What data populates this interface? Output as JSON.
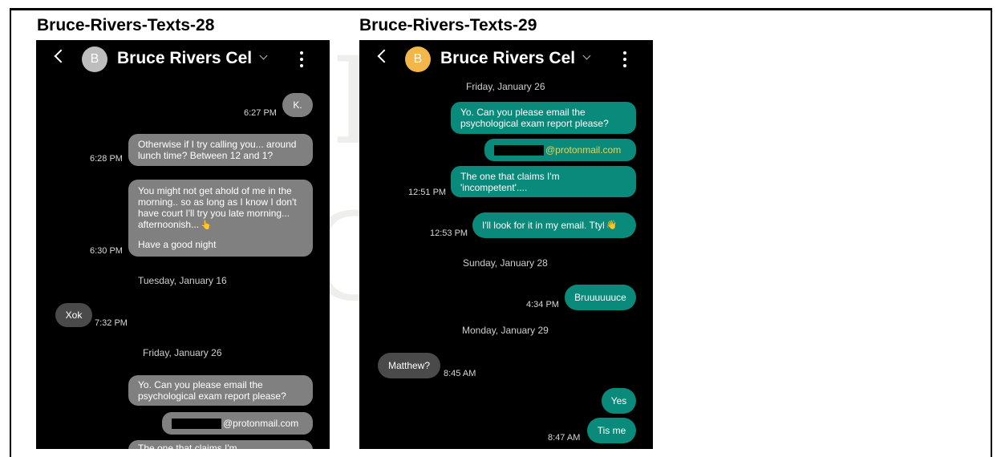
{
  "captions": {
    "left": "Bruce-Rivers-Texts-28",
    "right": "Bruce-Rivers-Texts-29"
  },
  "watermark": {
    "line1": "AL",
    "line2": "CH"
  },
  "colors": {
    "incoming_bubble": "#808080",
    "incoming_bubble_dark": "#4a4a4a",
    "outgoing_bubble": "#0a8a7a",
    "email_link": "#f0d24a",
    "avatar_left": "#bdbdbd",
    "avatar_right": "#f2b64a"
  },
  "phone_left": {
    "header": {
      "avatar_letter": "B",
      "contact": "Bruce Rivers Cel"
    },
    "messages": {
      "m1": {
        "text": "K.",
        "time": "6:27 PM"
      },
      "m2": {
        "text": "Otherwise if I try calling you... around lunch time? Between 12 and 1?",
        "time": "6:28 PM"
      },
      "m3": {
        "text": "You might not get ahold of me in the morning.. so as long as I know I don't have court I'll try you late morning... afternoonish...",
        "emoji": "👆",
        "extra": "Have a good night",
        "time": "6:30 PM"
      },
      "d1": "Tuesday, January 16",
      "m4": {
        "text": "Xok",
        "time": "7:32 PM"
      },
      "d2": "Friday, January 26",
      "m5": {
        "text": "Yo. Can you please email the psychological exam report please?"
      },
      "m6": {
        "email": "@protonmail.com"
      },
      "m7": {
        "text": "The one that claims I'm"
      }
    }
  },
  "phone_right": {
    "header": {
      "avatar_letter": "B",
      "contact": "Bruce Rivers Cel"
    },
    "messages": {
      "d1": "Friday, January 26",
      "m1": {
        "text": "Yo. Can you please email the psychological exam report please?"
      },
      "m2": {
        "email": "@protonmail.com"
      },
      "m3": {
        "text": "The one that claims I'm 'incompetent'....",
        "time": "12:51 PM"
      },
      "m4": {
        "text": "I'll look for it in my email. Ttyl",
        "emoji": "👋",
        "time": "12:53 PM"
      },
      "d2": "Sunday, January 28",
      "m5": {
        "text": "Bruuuuuuce",
        "time": "4:34 PM"
      },
      "d3": "Monday, January 29",
      "m6": {
        "text": "Matthew?",
        "time": "8:45 AM"
      },
      "m7": {
        "text": "Yes"
      },
      "m8": {
        "text": "Tis me",
        "time": "8:47 AM"
      }
    }
  }
}
